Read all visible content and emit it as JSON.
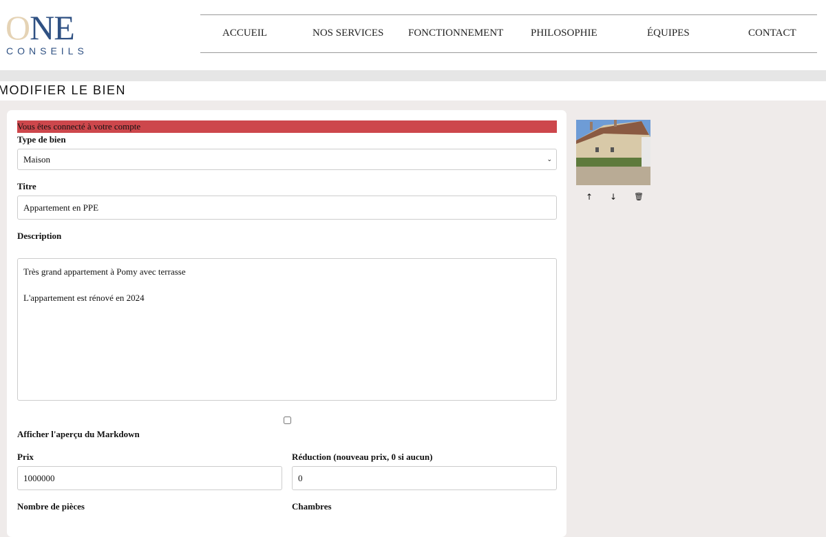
{
  "logo": {
    "main": "ONE",
    "sub": "CONSEILS"
  },
  "nav": [
    "ACCUEIL",
    "NOS SERVICES",
    "FONCTIONNEMENT",
    "PHILOSOPHIE",
    "ÉQUIPES",
    "CONTACT"
  ],
  "page_title": "MODIFIER LE BIEN",
  "alert": "Vous êtes connecté à votre compte",
  "form": {
    "type_label": "Type de bien",
    "type_value": "Maison",
    "title_label": "Titre",
    "title_value": "Appartement en PPE",
    "desc_label": "Description",
    "desc_lines": [
      "Très grand appartement à Pomy avec terrasse",
      "L'appartement est rénové en 2024"
    ],
    "markdown_label": "Afficher l'aperçu du Markdown",
    "markdown_checked": false,
    "price_label": "Prix",
    "price_value": "1000000",
    "reduction_label": "Réduction (nouveau prix, 0 si aucun)",
    "reduction_value": "0",
    "rooms_label": "Nombre de pièces",
    "bedrooms_label": "Chambres"
  },
  "photo_actions": {
    "up": "↑",
    "down": "↓",
    "delete": "🗑"
  },
  "colors": {
    "brand": "#2f5183",
    "alert": "#cd474c"
  }
}
